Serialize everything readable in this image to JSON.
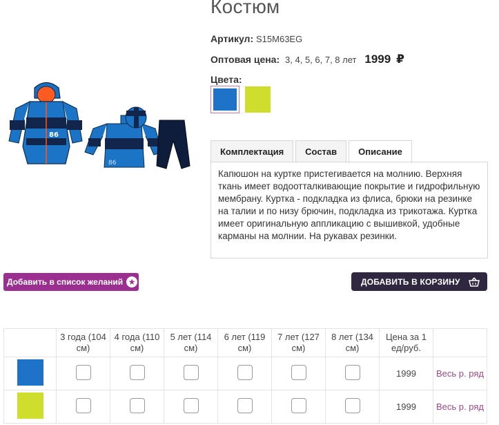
{
  "product": {
    "title": "Костюм",
    "sku_label": "Артикул:",
    "sku_value": "S15M63EG",
    "price_label": "Оптовая цена:",
    "sizes_text": "3, 4, 5, 6, 7, 8 лет",
    "price": "1999",
    "currency": "₽",
    "colors_label": "Цвета:",
    "colors": [
      {
        "hex": "#1e73c8",
        "selected": true
      },
      {
        "hex": "#cfdd2c",
        "selected": false
      }
    ]
  },
  "tabs": [
    {
      "label": "Комплектация",
      "active": false
    },
    {
      "label": "Состав",
      "active": false
    },
    {
      "label": "Описание",
      "active": true
    }
  ],
  "description": "Капюшон на куртке пристегивается на молнию. Верхняя ткань имеет водоотталкивающие покрытие и гидрофильную мембрану. Куртка - подкладка из флиса, брюки на резинке на талии и по низу брючин, подкладка из трикотажа. Куртка имеет оригинальную аппликацию с вышивкой, удобные карманы на молнии. На рукавах резинки.",
  "image_labels": {
    "badge_jacket": "86",
    "badge_sweater": "86"
  },
  "buttons": {
    "wishlist": "Добавить в список желаний",
    "wishlist_icon": "star-icon",
    "cart": "ДОБАВИТЬ В КОРЗИНУ",
    "cart_icon": "basket-icon"
  },
  "size_table": {
    "headers": [
      "",
      "3 года (104 см)",
      "4 года (110 см)",
      "5 лет (114 см)",
      "6 лет (119 см)",
      "7 лет (127 см)",
      "8 лет (134 см)",
      "Цена за 1 ед/руб.",
      ""
    ],
    "rows": [
      {
        "color": "#1e73c8",
        "price": "1999",
        "link": "Весь р. ряд"
      },
      {
        "color": "#cfdd2c",
        "price": "1999",
        "link": "Весь р. ряд"
      }
    ]
  },
  "accent_colors": {
    "wishlist_bg": "#9b2f8f",
    "cart_bg": "#2f2840",
    "link": "#9b4a82"
  }
}
